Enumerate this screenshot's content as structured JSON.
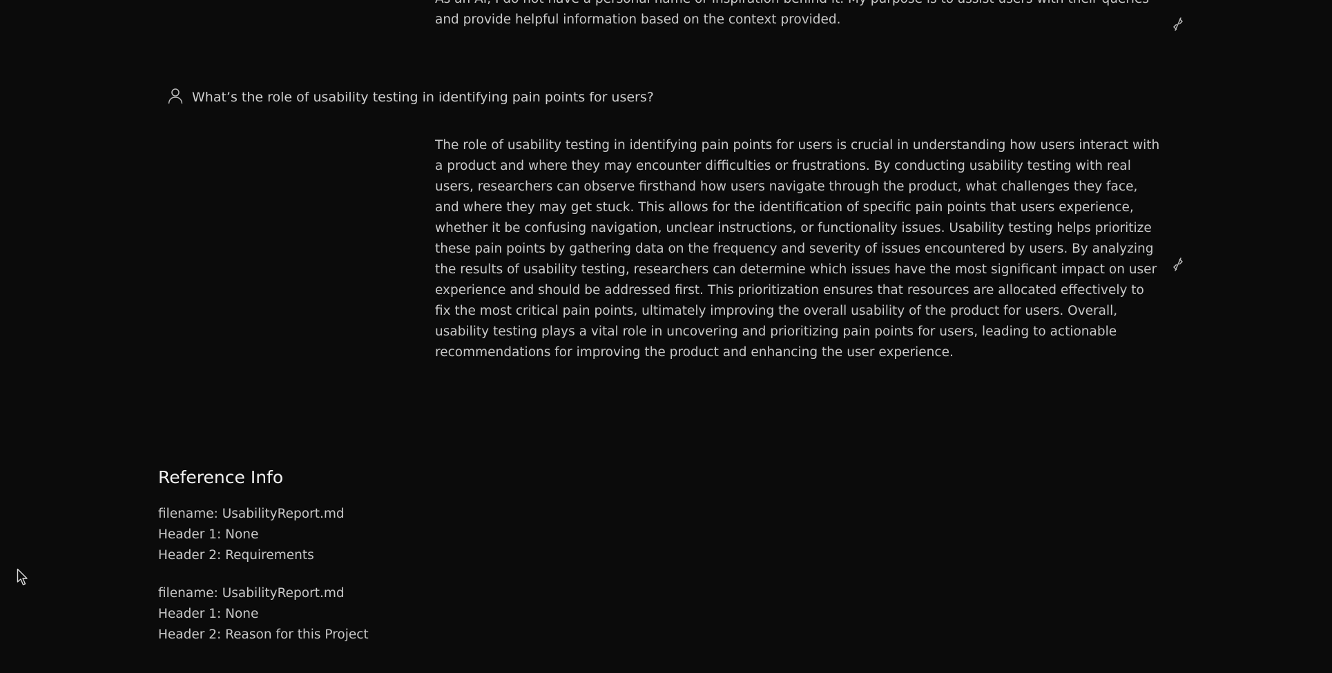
{
  "previous_answer": {
    "text": "As an AI, I do not have a personal name or inspiration behind it. My purpose is to assist users with their queries and provide helpful information based on the context provided."
  },
  "user_message": {
    "icon": "user-icon",
    "text": "What’s the role of usability testing in identifying pain points for users?"
  },
  "answer": {
    "text": "The role of usability testing in identifying pain points for users is crucial in understanding how users interact with a product and where they may encounter difficulties or frustrations. By conducting usability testing with real users, researchers can observe firsthand how users navigate through the product, what challenges they face, and where they may get stuck. This allows for the identification of specific pain points that users experience, whether it be confusing navigation, unclear instructions, or functionality issues. Usability testing helps prioritize these pain points by gathering data on the frequency and severity of issues encountered by users. By analyzing the results of usability testing, researchers can determine which issues have the most significant impact on user experience and should be addressed first. This prioritization ensures that resources are allocated effectively to fix the most critical pain points, ultimately improving the overall usability of the product for users. Overall, usability testing plays a vital role in uncovering and prioritizing pain points for users, leading to actionable recommendations for improving the product and enhancing the user experience.",
    "action_icon": "unlink-icon"
  },
  "reference_info": {
    "title": "Reference Info",
    "items": [
      {
        "filename": "filename: UsabilityReport.md",
        "header1": "Header 1: None",
        "header2": "Header 2: Requirements"
      },
      {
        "filename": "filename: UsabilityReport.md",
        "header1": "Header 1: None",
        "header2": "Header 2: Reason for this Project"
      }
    ]
  },
  "colors": {
    "background": "#0b0b0b",
    "text": "#c9c9c9",
    "heading": "#f2f2f2"
  }
}
